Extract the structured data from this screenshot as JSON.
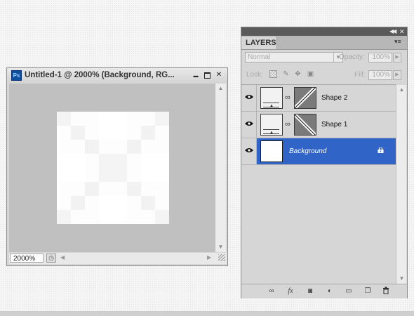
{
  "document_window": {
    "title": "Untitled-1 @ 2000% (Background, RG...",
    "app_icon_label": "Ps",
    "minimize_glyph": "▬",
    "close_glyph": "✕",
    "zoom_value": "2000%",
    "status_icon_glyph": "◷",
    "scroll_up_glyph": "▲",
    "scroll_down_glyph": "▼",
    "scroll_left_glyph": "◀",
    "scroll_right_glyph": "▶",
    "canvas_pixels": [
      [
        "#f4f4f4",
        "#fdfdfd",
        "#fdfdfd",
        "#ffffff",
        "#ffffff",
        "#fdfdfd",
        "#fdfdfd",
        "#f4f4f4"
      ],
      [
        "#fdfdfd",
        "#f2f2f2",
        "#fdfdfd",
        "#ffffff",
        "#ffffff",
        "#fdfdfd",
        "#f2f2f2",
        "#fdfdfd"
      ],
      [
        "#fdfdfd",
        "#fdfdfd",
        "#f2f2f2",
        "#fdfdfd",
        "#fdfdfd",
        "#f2f2f2",
        "#fdfdfd",
        "#fdfdfd"
      ],
      [
        "#ffffff",
        "#ffffff",
        "#fdfdfd",
        "#f4f4f4",
        "#f4f4f4",
        "#fdfdfd",
        "#ffffff",
        "#ffffff"
      ],
      [
        "#ffffff",
        "#ffffff",
        "#fdfdfd",
        "#f4f4f4",
        "#f4f4f4",
        "#fdfdfd",
        "#ffffff",
        "#ffffff"
      ],
      [
        "#fdfdfd",
        "#fdfdfd",
        "#f2f2f2",
        "#fdfdfd",
        "#fdfdfd",
        "#f2f2f2",
        "#fdfdfd",
        "#fdfdfd"
      ],
      [
        "#fdfdfd",
        "#f2f2f2",
        "#fdfdfd",
        "#ffffff",
        "#ffffff",
        "#fdfdfd",
        "#f2f2f2",
        "#fdfdfd"
      ],
      [
        "#f4f4f4",
        "#fdfdfd",
        "#fdfdfd",
        "#ffffff",
        "#ffffff",
        "#fdfdfd",
        "#fdfdfd",
        "#f4f4f4"
      ]
    ]
  },
  "layers_panel": {
    "tab_label": "LAYERS",
    "collapse_glyph": "◀◀",
    "close_glyph": "✕",
    "menu_glyph": "▾≡",
    "blend_mode": "Normal",
    "dropdown_glyph": "▼",
    "opacity_label": "Opacity:",
    "opacity_value": "100%",
    "lock_label": "Lock:",
    "lock_icons": [
      "lock-transparent-icon",
      "lock-paint-icon",
      "lock-move-icon",
      "lock-all-icon"
    ],
    "lock_glyphs": {
      "paint": "✎",
      "move": "✥",
      "all": "▣"
    },
    "fill_label": "Fill:",
    "fill_value": "100%",
    "arrow_glyph": "▶",
    "link_glyph": "∞",
    "layers": [
      {
        "name": "Shape 2",
        "visible": true,
        "selected": false,
        "type": "shape"
      },
      {
        "name": "Shape 1",
        "visible": true,
        "selected": false,
        "type": "shape"
      },
      {
        "name": "Background",
        "visible": true,
        "selected": true,
        "type": "background",
        "locked": true
      }
    ],
    "selection_color": "#3064c6",
    "footer_icons": [
      {
        "name": "link-layers-icon",
        "glyph": "∞"
      },
      {
        "name": "fx-icon",
        "glyph": "fx"
      },
      {
        "name": "add-mask-icon",
        "glyph": "◙"
      },
      {
        "name": "adjustment-layer-icon",
        "glyph": "◐"
      },
      {
        "name": "new-group-icon",
        "glyph": "▭"
      },
      {
        "name": "new-layer-icon",
        "glyph": "❐"
      },
      {
        "name": "trash-icon",
        "glyph": "🗑"
      }
    ]
  }
}
